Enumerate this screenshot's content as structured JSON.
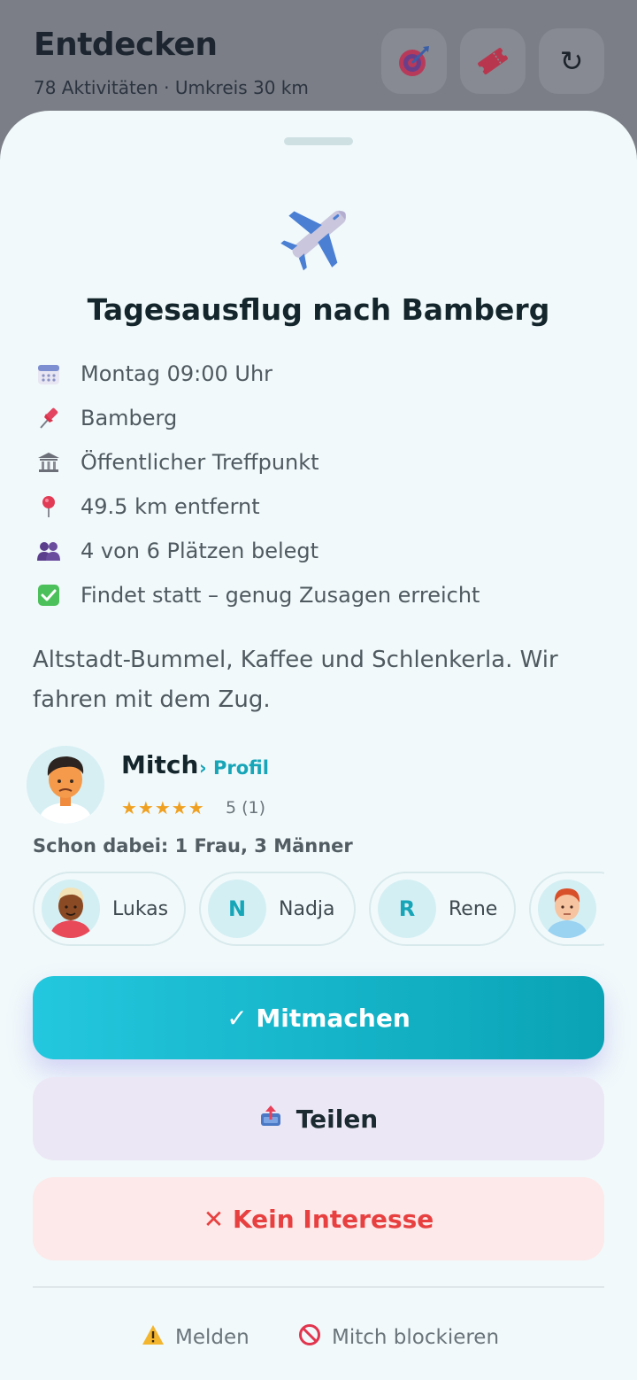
{
  "header": {
    "title": "Entdecken",
    "subtitle": "78 Aktivitäten · Umkreis 30 km",
    "icons": [
      "target-icon",
      "ticket-icon",
      "refresh-icon"
    ],
    "refresh_glyph": "↻"
  },
  "activity": {
    "icon": "airplane-icon",
    "title": "Tagesausflug nach Bamberg",
    "details": [
      {
        "icon": "calendar-icon",
        "text": "Montag 09:00 Uhr"
      },
      {
        "icon": "pushpin-icon",
        "text": "Bamberg"
      },
      {
        "icon": "building-icon",
        "text": "Öffentlicher Treffpunkt"
      },
      {
        "icon": "location-pin-icon",
        "text": "49.5 km entfernt"
      },
      {
        "icon": "people-icon",
        "text": "4 von 6 Plätzen belegt"
      },
      {
        "icon": "checkmark-icon",
        "text": "Findet statt – genug Zusagen erreicht"
      }
    ],
    "description": "Altstadt-Bummel, Kaffee und Schlenkerla. Wir fahren mit dem Zug."
  },
  "host": {
    "name": "Mitch",
    "profile_link": "› Profil",
    "stars": "★★★★★",
    "rating": "5 (1)"
  },
  "participants": {
    "summary": "Schon dabei: 1 Frau, 3 Männer",
    "list": [
      {
        "name": "Lukas",
        "initial": ""
      },
      {
        "name": "Nadja",
        "initial": "N"
      },
      {
        "name": "Rene",
        "initial": "R"
      },
      {
        "name": "",
        "initial": ""
      }
    ]
  },
  "actions": {
    "join": "✓ Mitmachen",
    "share": "Teilen",
    "not_interested": "✕ Kein Interesse",
    "report": "Melden",
    "block": "Mitch blockieren"
  },
  "colors": {
    "accent": "#17a5b8",
    "join_start": "#23c7de",
    "join_end": "#0aa3b5",
    "danger": "#e84040",
    "star": "#f0a020"
  }
}
